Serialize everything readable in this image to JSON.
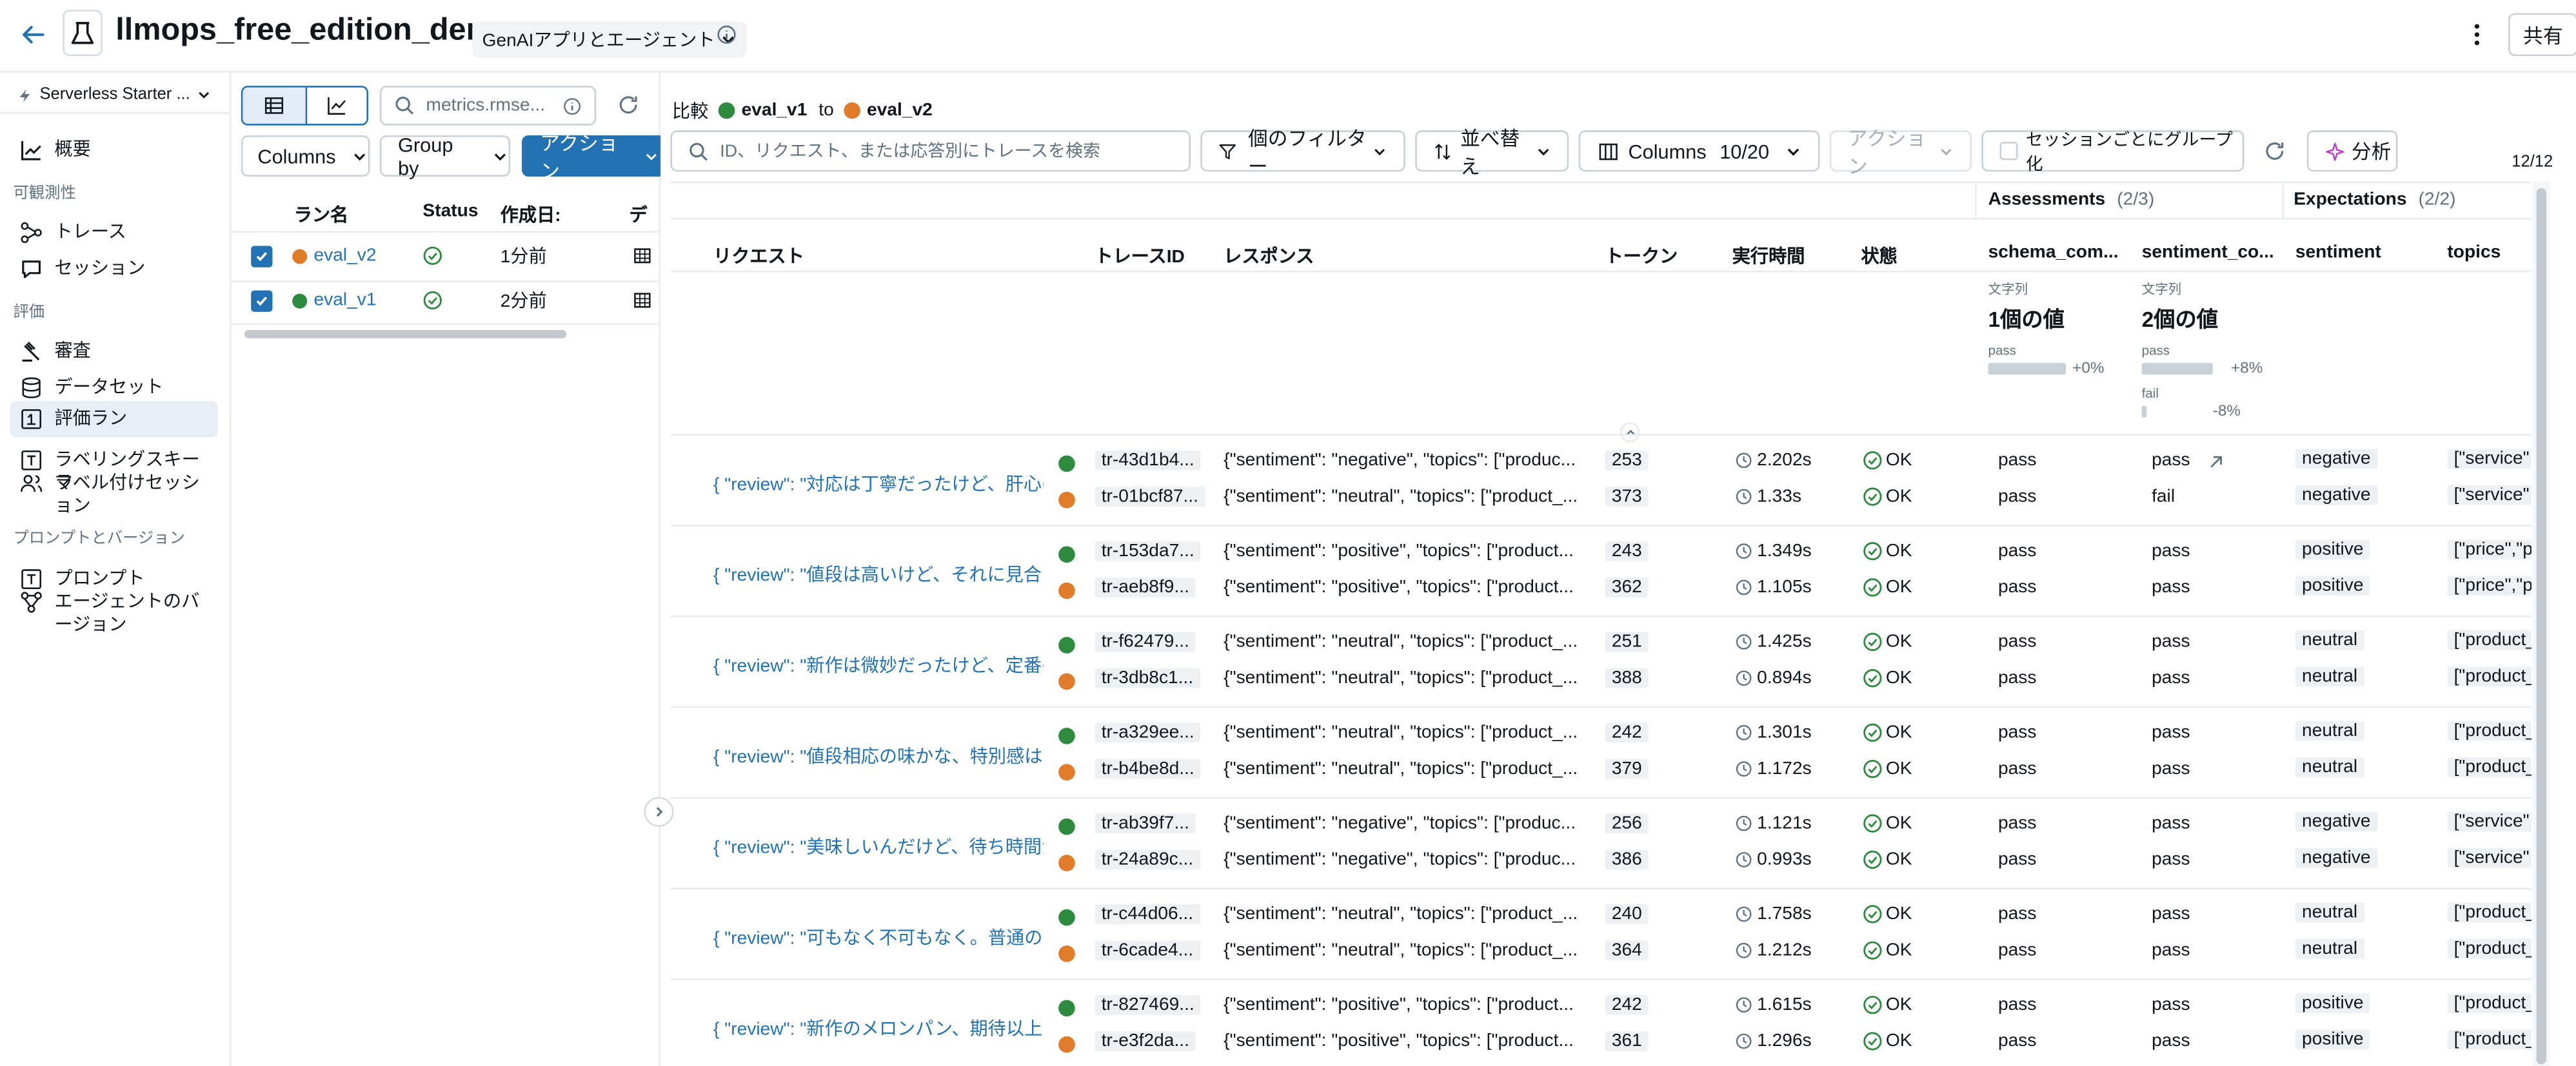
{
  "header": {
    "title": "llmops_free_edition_demo",
    "type_label": "GenAIアプリとエージェント",
    "share_label": "共有"
  },
  "workspace": "Serverless Starter ...",
  "sidebar": {
    "items_top": [
      {
        "label": "概要"
      }
    ],
    "section_observability": "可観測性",
    "observability_items": [
      {
        "label": "トレース"
      },
      {
        "label": "セッション"
      }
    ],
    "section_eval": "評価",
    "eval_items": [
      {
        "label": "審査"
      },
      {
        "label": "データセット"
      },
      {
        "label": "評価ラン"
      },
      {
        "label": "ラベリングスキーマ"
      },
      {
        "label": "ラベル付けセッション"
      }
    ],
    "section_prompts": "プロンプトとバージョン",
    "prompt_items": [
      {
        "label": "プロンプト"
      },
      {
        "label": "エージェントのバージョン"
      }
    ]
  },
  "runs_panel": {
    "search_placeholder": "metrics.rmse...",
    "columns_label": "Columns",
    "group_by_label": "Group by",
    "action_label": "アクション",
    "col_run_name": "ラン名",
    "col_status": "Status",
    "col_created": "作成日:",
    "col_extra": "デ",
    "runs": [
      {
        "name": "eval_v2",
        "created": "1分前",
        "color": "#e07b2a"
      },
      {
        "name": "eval_v1",
        "created": "2分前",
        "color": "#2d8a3e"
      }
    ]
  },
  "compare": {
    "label": "比較",
    "from": "eval_v1",
    "to_word": "to",
    "to": "eval_v2"
  },
  "toolbar": {
    "search_placeholder": "ID、リクエスト、または応答別にトレースを検索",
    "filter_label": "個のフィルター",
    "sort_label": "並べ替え",
    "columns_label": "Columns",
    "columns_count": "10/20",
    "action_label": "アクション",
    "group_session_label": "セッションごとにグループ化",
    "analyze_label": "分析",
    "page_count": "12/12"
  },
  "table": {
    "assessments_group": "Assessments",
    "assessments_count": "(2/3)",
    "expectations_group": "Expectations",
    "expectations_count": "(2/2)",
    "headers": {
      "request": "リクエスト",
      "trace_id": "トレースID",
      "response": "レスポンス",
      "tokens": "トークン",
      "exec_time": "実行時間",
      "state": "状態",
      "schema": "schema_com...",
      "sentiment_co": "sentiment_co...",
      "sentiment": "sentiment",
      "topics": "topics"
    },
    "summary": {
      "schema": {
        "type": "文字列",
        "value": "1個の値",
        "pass_label": "pass",
        "pass_delta": "+0%"
      },
      "sentiment_co": {
        "type": "文字列",
        "value": "2個の値",
        "pass_label": "pass",
        "pass_delta": "+8%",
        "fail_label": "fail",
        "fail_delta": "-8%"
      }
    },
    "rows": [
      {
        "request": "{ \"review\": \"対応は丁寧だったけど、肝心の...",
        "a": {
          "id": "tr-43d1b4...",
          "resp": "{\"sentiment\": \"negative\", \"topics\": [\"produc...",
          "tokens": "253",
          "time": "2.202s",
          "state": "OK",
          "schema": "pass",
          "sco": "pass",
          "sent": "negative",
          "topics": "[\"service\""
        },
        "b": {
          "id": "tr-01bcf87...",
          "resp": "{\"sentiment\": \"neutral\", \"topics\": [\"product_...",
          "tokens": "373",
          "time": "1.33s",
          "state": "OK",
          "schema": "pass",
          "sco": "fail",
          "sent": "negative",
          "topics": "[\"service\""
        }
      },
      {
        "request": "{ \"review\": \"値段は高いけど、それに見合う...",
        "a": {
          "id": "tr-153da7...",
          "resp": "{\"sentiment\": \"positive\", \"topics\": [\"product...",
          "tokens": "243",
          "time": "1.349s",
          "state": "OK",
          "schema": "pass",
          "sco": "pass",
          "sent": "positive",
          "topics": "[\"price\",\"p"
        },
        "b": {
          "id": "tr-aeb8f9...",
          "resp": "{\"sentiment\": \"positive\", \"topics\": [\"product...",
          "tokens": "362",
          "time": "1.105s",
          "state": "OK",
          "schema": "pass",
          "sco": "pass",
          "sent": "positive",
          "topics": "[\"price\",\"p"
        }
      },
      {
        "request": "{ \"review\": \"新作は微妙だったけど、定番の...",
        "a": {
          "id": "tr-f62479...",
          "resp": "{\"sentiment\": \"neutral\", \"topics\": [\"product_...",
          "tokens": "251",
          "time": "1.425s",
          "state": "OK",
          "schema": "pass",
          "sco": "pass",
          "sent": "neutral",
          "topics": "[\"product_"
        },
        "b": {
          "id": "tr-3db8c1...",
          "resp": "{\"sentiment\": \"neutral\", \"topics\": [\"product_...",
          "tokens": "388",
          "time": "0.894s",
          "state": "OK",
          "schema": "pass",
          "sco": "pass",
          "sent": "neutral",
          "topics": "[\"product_"
        }
      },
      {
        "request": "{ \"review\": \"値段相応の味かな、特別感はな...",
        "a": {
          "id": "tr-a329ee...",
          "resp": "{\"sentiment\": \"neutral\", \"topics\": [\"product_...",
          "tokens": "242",
          "time": "1.301s",
          "state": "OK",
          "schema": "pass",
          "sco": "pass",
          "sent": "neutral",
          "topics": "[\"product_"
        },
        "b": {
          "id": "tr-b4be8d...",
          "resp": "{\"sentiment\": \"neutral\", \"topics\": [\"product_...",
          "tokens": "379",
          "time": "1.172s",
          "state": "OK",
          "schema": "pass",
          "sco": "pass",
          "sent": "neutral",
          "topics": "[\"product_"
        }
      },
      {
        "request": "{ \"review\": \"美味しいんだけど、待ち時間が...",
        "a": {
          "id": "tr-ab39f7...",
          "resp": "{\"sentiment\": \"negative\", \"topics\": [\"produc...",
          "tokens": "256",
          "time": "1.121s",
          "state": "OK",
          "schema": "pass",
          "sco": "pass",
          "sent": "negative",
          "topics": "[\"service\""
        },
        "b": {
          "id": "tr-24a89c...",
          "resp": "{\"sentiment\": \"negative\", \"topics\": [\"produc...",
          "tokens": "386",
          "time": "0.993s",
          "state": "OK",
          "schema": "pass",
          "sco": "pass",
          "sent": "negative",
          "topics": "[\"service\""
        }
      },
      {
        "request": "{ \"review\": \"可もなく不可もなく。普通のパ...",
        "a": {
          "id": "tr-c44d06...",
          "resp": "{\"sentiment\": \"neutral\", \"topics\": [\"product_...",
          "tokens": "240",
          "time": "1.758s",
          "state": "OK",
          "schema": "pass",
          "sco": "pass",
          "sent": "neutral",
          "topics": "[\"product_"
        },
        "b": {
          "id": "tr-6cade4...",
          "resp": "{\"sentiment\": \"neutral\", \"topics\": [\"product_...",
          "tokens": "364",
          "time": "1.212s",
          "state": "OK",
          "schema": "pass",
          "sco": "pass",
          "sent": "neutral",
          "topics": "[\"product_"
        }
      },
      {
        "request": "{ \"review\": \"新作のメロンパン、期待以上の...",
        "a": {
          "id": "tr-827469...",
          "resp": "{\"sentiment\": \"positive\", \"topics\": [\"product...",
          "tokens": "242",
          "time": "1.615s",
          "state": "OK",
          "schema": "pass",
          "sco": "pass",
          "sent": "positive",
          "topics": "[\"product_"
        },
        "b": {
          "id": "tr-e3f2da...",
          "resp": "{\"sentiment\": \"positive\", \"topics\": [\"product...",
          "tokens": "361",
          "time": "1.296s",
          "state": "OK",
          "schema": "pass",
          "sco": "pass",
          "sent": "positive",
          "topics": "[\"product_"
        }
      }
    ]
  },
  "colors": {
    "accent": "#2272b4",
    "v1": "#2d8a3e",
    "v2": "#e07b2a"
  }
}
